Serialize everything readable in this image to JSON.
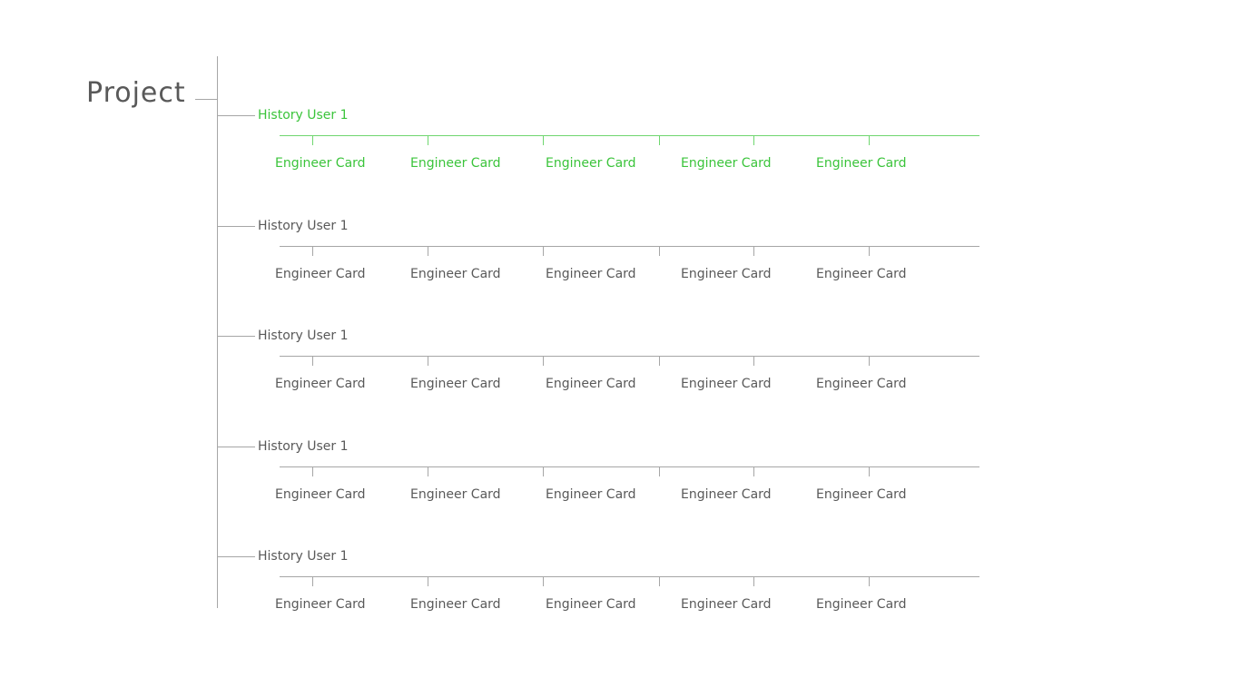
{
  "project": {
    "title": "Project"
  },
  "groups": [
    {
      "label": "History User 1",
      "active": true,
      "cards": [
        "Engineer Card",
        "Engineer Card",
        "Engineer Card",
        "Engineer Card",
        "Engineer Card"
      ]
    },
    {
      "label": "History User 1",
      "active": false,
      "cards": [
        "Engineer Card",
        "Engineer Card",
        "Engineer Card",
        "Engineer Card",
        "Engineer Card"
      ]
    },
    {
      "label": "History User 1",
      "active": false,
      "cards": [
        "Engineer Card",
        "Engineer Card",
        "Engineer Card",
        "Engineer Card",
        "Engineer Card"
      ]
    },
    {
      "label": "History User 1",
      "active": false,
      "cards": [
        "Engineer Card",
        "Engineer Card",
        "Engineer Card",
        "Engineer Card",
        "Engineer Card"
      ]
    },
    {
      "label": "History User 1",
      "active": false,
      "cards": [
        "Engineer Card",
        "Engineer Card",
        "Engineer Card",
        "Engineer Card",
        "Engineer Card"
      ]
    }
  ],
  "colors": {
    "active": "#3bc43b",
    "normal": "#595959",
    "line": "#a6a6a6"
  }
}
